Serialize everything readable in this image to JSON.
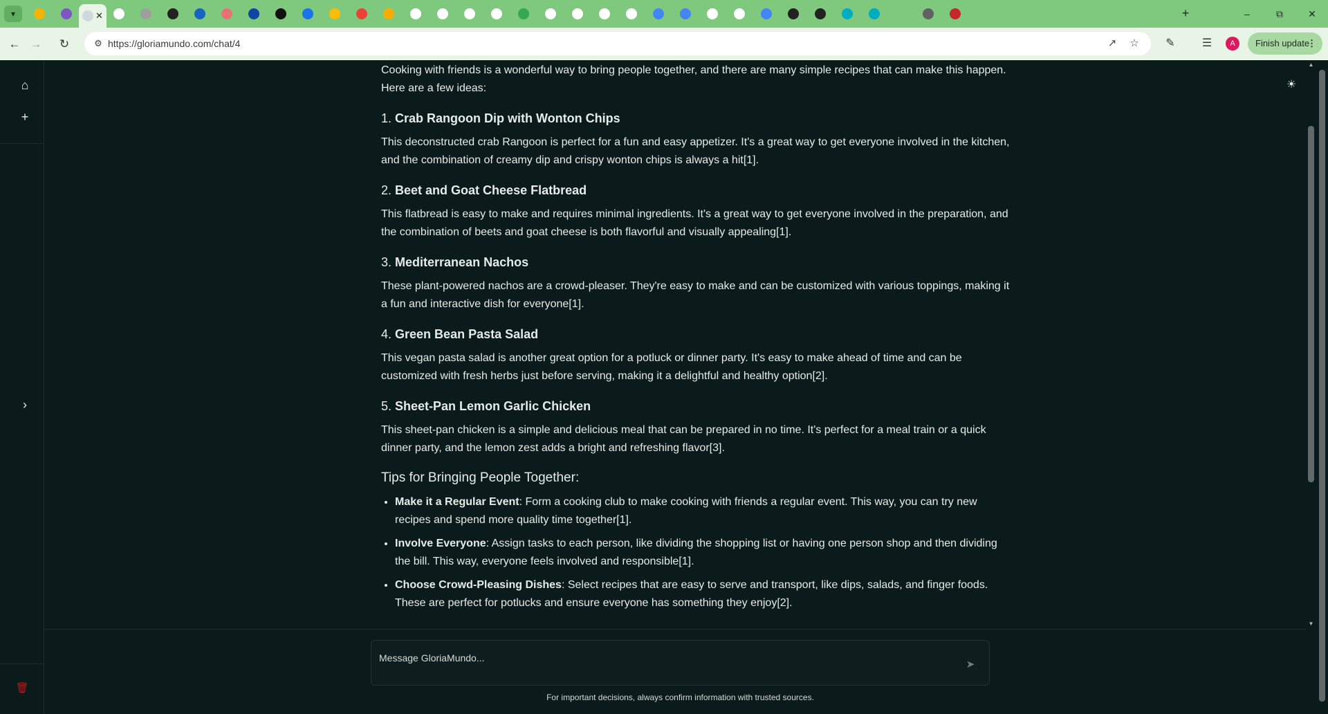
{
  "browser": {
    "url": "https://gloriamundo.com/chat/4",
    "finish_update_label": "Finish update",
    "profile_initial": "A",
    "tabs": [
      {
        "icon": "gloriamundo-favicon",
        "color": "#f4b400"
      },
      {
        "icon": "gloriamundo-favicon",
        "color": "#7e57c2"
      },
      {
        "icon": "active-tab-favicon",
        "color": "#cfd8dc"
      },
      {
        "icon": "google-favicon",
        "color": "#ffffff"
      },
      {
        "icon": "site-favicon",
        "color": "#9e9e9e"
      },
      {
        "icon": "site-favicon",
        "color": "#212121"
      },
      {
        "icon": "site-favicon",
        "color": "#1565c0"
      },
      {
        "icon": "site-favicon",
        "color": "#e57373"
      },
      {
        "icon": "site-favicon",
        "color": "#0d47a1"
      },
      {
        "icon": "notion-favicon",
        "color": "#111111"
      },
      {
        "icon": "gemini-favicon",
        "color": "#1a73e8"
      },
      {
        "icon": "gemini-favicon",
        "color": "#fbbc04"
      },
      {
        "icon": "gmail-favicon",
        "color": "#ea4335"
      },
      {
        "icon": "analytics-favicon",
        "color": "#f9ab00"
      },
      {
        "icon": "google-favicon",
        "color": "#ffffff"
      },
      {
        "icon": "google-favicon",
        "color": "#ffffff"
      },
      {
        "icon": "google-favicon",
        "color": "#ffffff"
      },
      {
        "icon": "google-favicon",
        "color": "#ffffff"
      },
      {
        "icon": "chrome-favicon",
        "color": "#34a853"
      },
      {
        "icon": "google-favicon",
        "color": "#ffffff"
      },
      {
        "icon": "google-favicon",
        "color": "#ffffff"
      },
      {
        "icon": "google-favicon",
        "color": "#ffffff"
      },
      {
        "icon": "google-favicon",
        "color": "#ffffff"
      },
      {
        "icon": "site-favicon",
        "color": "#4285f4"
      },
      {
        "icon": "site-favicon",
        "color": "#4285f4"
      },
      {
        "icon": "google-favicon",
        "color": "#ffffff"
      },
      {
        "icon": "google-favicon",
        "color": "#ffffff"
      },
      {
        "icon": "site-favicon",
        "color": "#4285f4"
      },
      {
        "icon": "site-favicon",
        "color": "#212121"
      },
      {
        "icon": "play-favicon",
        "color": "#212121"
      },
      {
        "icon": "site-favicon",
        "color": "#00acc1"
      },
      {
        "icon": "site-favicon",
        "color": "#00acc1"
      },
      {
        "icon": "blank-favicon",
        "color": "#7fc97f"
      },
      {
        "icon": "site-favicon",
        "color": "#616161"
      },
      {
        "icon": "site-favicon",
        "color": "#c62828"
      }
    ]
  },
  "app": {
    "message": {
      "intro": "Cooking with friends is a wonderful way to bring people together, and there are many simple recipes that can make this happen. Here are a few ideas:",
      "recipes": [
        {
          "num": "1.",
          "title": "Crab Rangoon Dip with Wonton Chips",
          "body": "This deconstructed crab Rangoon is perfect for a fun and easy appetizer. It's a great way to get everyone involved in the kitchen, and the combination of creamy dip and crispy wonton chips is always a hit[1]."
        },
        {
          "num": "2.",
          "title": "Beet and Goat Cheese Flatbread",
          "body": "This flatbread is easy to make and requires minimal ingredients. It's a great way to get everyone involved in the preparation, and the combination of beets and goat cheese is both flavorful and visually appealing[1]."
        },
        {
          "num": "3.",
          "title": "Mediterranean Nachos",
          "body": "These plant-powered nachos are a crowd-pleaser. They're easy to make and can be customized with various toppings, making it a fun and interactive dish for everyone[1]."
        },
        {
          "num": "4.",
          "title": "Green Bean Pasta Salad",
          "body": "This vegan pasta salad is another great option for a potluck or dinner party. It's easy to make ahead of time and can be customized with fresh herbs just before serving, making it a delightful and healthy option[2]."
        },
        {
          "num": "5.",
          "title": "Sheet-Pan Lemon Garlic Chicken",
          "body": "This sheet-pan chicken is a simple and delicious meal that can be prepared in no time. It's perfect for a meal train or a quick dinner party, and the lemon zest adds a bright and refreshing flavor[3]."
        }
      ],
      "tips_heading": "Tips for Bringing People Together:",
      "tips": [
        {
          "label": "Make it a Regular Event",
          "text": ": Form a cooking club to make cooking with friends a regular event. This way, you can try new recipes and spend more quality time together[1]."
        },
        {
          "label": "Involve Everyone",
          "text": ": Assign tasks to each person, like dividing the shopping list or having one person shop and then dividing the bill. This way, everyone feels involved and responsible[1]."
        },
        {
          "label": "Choose Crowd-Pleasing Dishes",
          "text": ": Select recipes that are easy to serve and transport, like dips, salads, and finger foods. These are perfect for potlucks and ensure everyone has something they enjoy[2]."
        }
      ]
    },
    "composer": {
      "placeholder": "Message GloriaMundo...",
      "disclaimer": "For important decisions, always confirm information with trusted sources."
    }
  }
}
